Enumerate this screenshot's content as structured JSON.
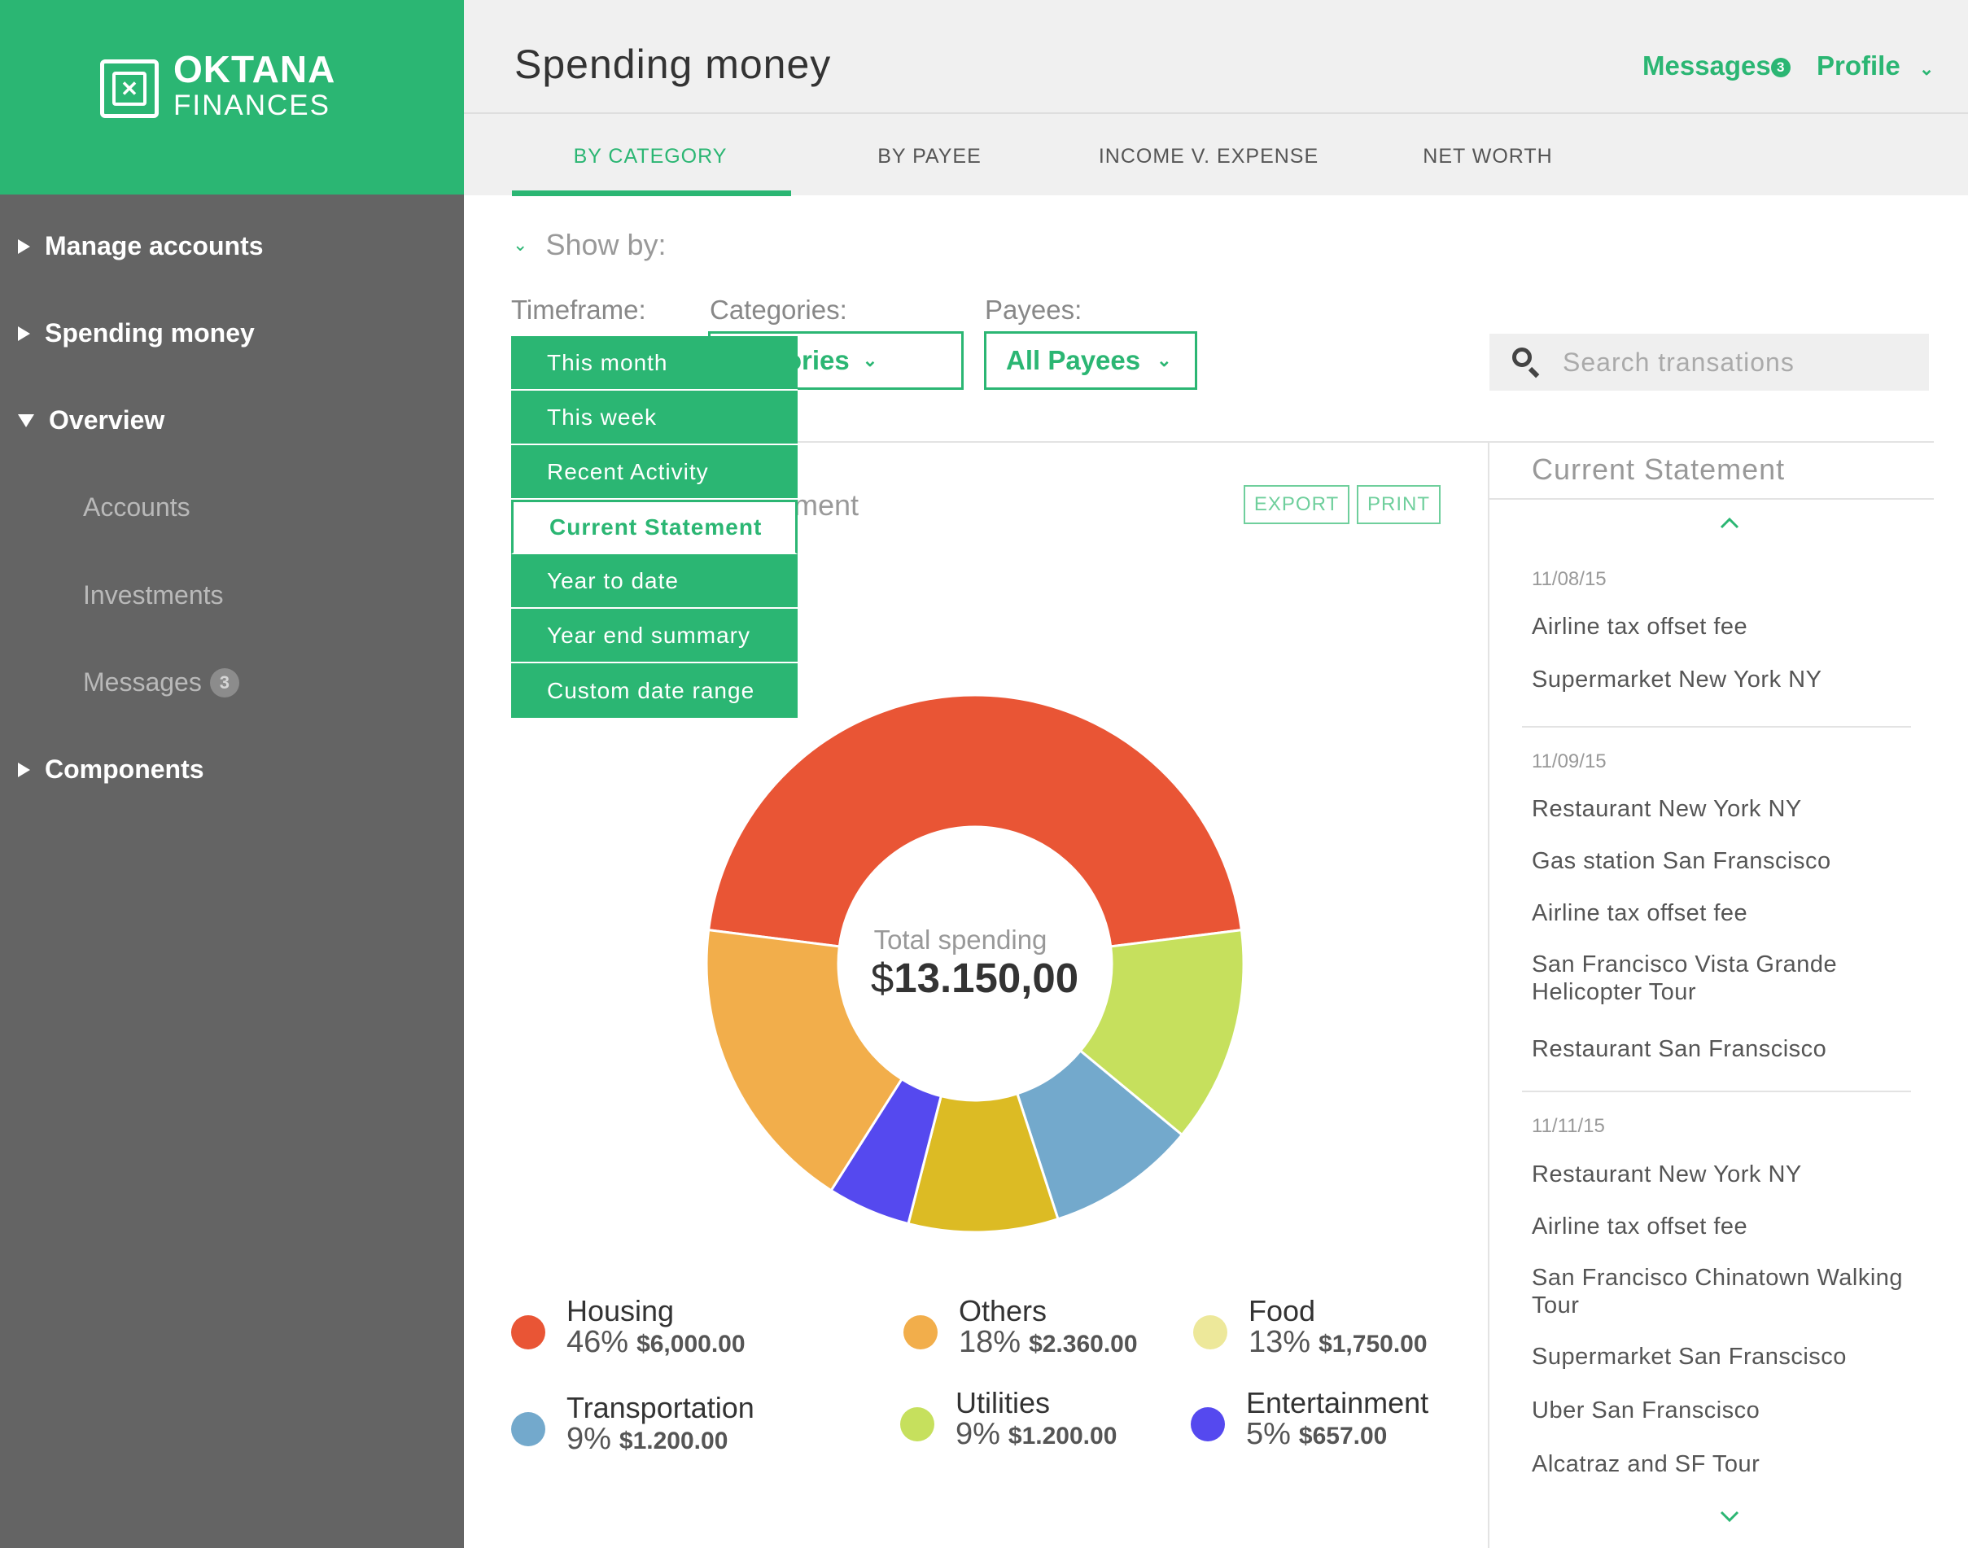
{
  "brand": {
    "name": "OKTANA",
    "subtitle": "FINANCES"
  },
  "sidebar": {
    "items": [
      {
        "label": "Manage accounts"
      },
      {
        "label": "Spending money"
      },
      {
        "label": "Overview"
      },
      {
        "label": "Components"
      }
    ],
    "subitems": [
      {
        "label": "Accounts"
      },
      {
        "label": "Investments"
      },
      {
        "label": "Messages",
        "badge": "3"
      }
    ]
  },
  "header": {
    "title": "Spending money",
    "messages_label": "Messages",
    "messages_badge": "3",
    "profile_label": "Profile"
  },
  "tabs": [
    {
      "label": "BY CATEGORY"
    },
    {
      "label": "BY PAYEE"
    },
    {
      "label": "INCOME V. EXPENSE"
    },
    {
      "label": "NET WORTH"
    }
  ],
  "filters": {
    "show_by": "Show by:",
    "timeframe_label": "Timeframe:",
    "categories_label": "Categories:",
    "categories_value": "ategories",
    "payees_label": "Payees:",
    "payees_value": "All Payees",
    "search_placeholder": "Search transations"
  },
  "timeframe_menu": [
    "This month",
    "This week",
    "Recent Activity",
    "Current Statement",
    "Year to date",
    "Year end summary",
    "Custom date range"
  ],
  "panel": {
    "title_fragment": "ment",
    "export_label": "EXPORT",
    "print_label": "PRINT"
  },
  "chart_data": {
    "type": "pie",
    "center_label": "Total spending",
    "center_currency": "$",
    "center_value": "13.150,00",
    "slices": [
      {
        "name": "Housing",
        "percent": 46,
        "amount": "$6,000.00",
        "color": "#e95535"
      },
      {
        "name": "Food",
        "percent": 13,
        "amount": "$1,750.00",
        "color": "#c6e05d"
      },
      {
        "name": "Transportation",
        "percent": 9,
        "amount": "$1.200.00",
        "color": "#73a9cc"
      },
      {
        "name": "Utilities",
        "percent": 9,
        "amount": "$1.200.00",
        "color": "#dcbb24"
      },
      {
        "name": "Entertainment",
        "percent": 5,
        "amount": "$657.00",
        "color": "#5549ef"
      },
      {
        "name": "Others",
        "percent": 18,
        "amount": "$2.360.00",
        "color": "#f2ae4b"
      }
    ]
  },
  "legend": {
    "housing": {
      "name": "Housing",
      "pct": "46%",
      "amt": "$6,000.00"
    },
    "others": {
      "name": "Others",
      "pct": "18%",
      "amt": "$2.360.00"
    },
    "food": {
      "name": "Food",
      "pct": "13%",
      "amt": "$1,750.00"
    },
    "transportation": {
      "name": "Transportation",
      "pct": "9%",
      "amt": "$1.200.00"
    },
    "utilities": {
      "name": "Utilities",
      "pct": "9%",
      "amt": "$1.200.00"
    },
    "entertainment": {
      "name": "Entertainment",
      "pct": "5%",
      "amt": "$657.00"
    }
  },
  "statement": {
    "title": "Current Statement",
    "groups": [
      {
        "date": "11/08/15",
        "items": [
          "Airline tax offset fee",
          "Supermarket New York NY"
        ]
      },
      {
        "date": "11/09/15",
        "items": [
          "Restaurant New York NY",
          "Gas station San Franscisco",
          "Airline tax offset fee",
          "San Francisco Vista Grande Helicopter Tour",
          "Restaurant San Franscisco"
        ]
      },
      {
        "date": "11/11/15",
        "items": [
          "Restaurant New York NY",
          "Airline tax offset fee",
          "San Francisco Chinatown Walking Tour",
          "Supermarket San Franscisco",
          "Uber San Franscisco",
          "Alcatraz and SF Tour"
        ]
      }
    ]
  }
}
